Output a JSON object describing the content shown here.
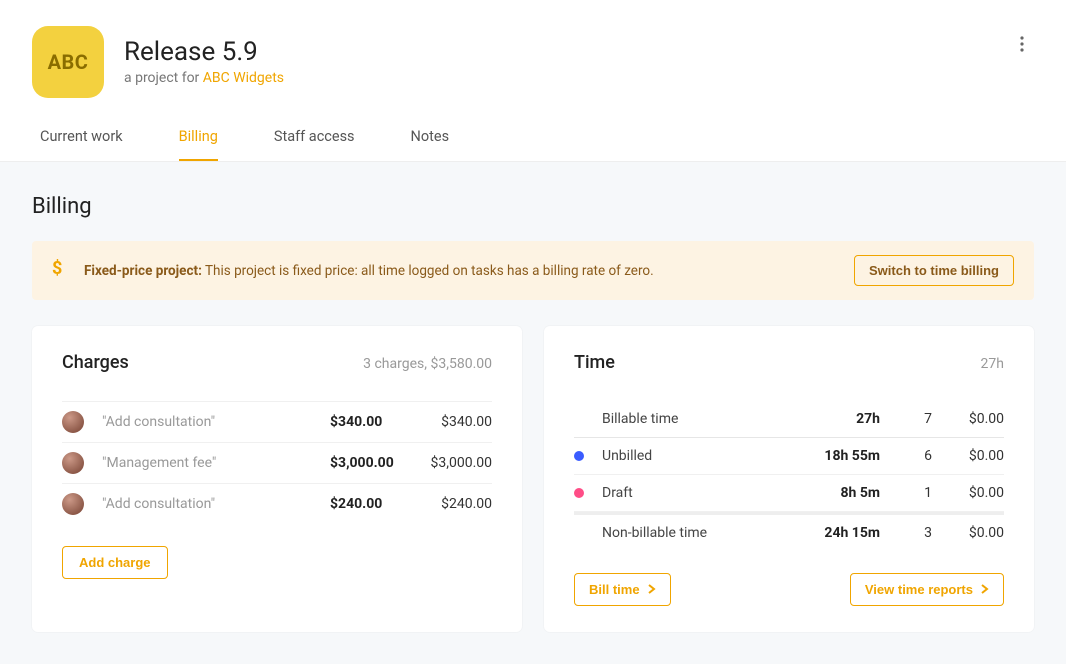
{
  "header": {
    "logo_text": "ABC",
    "title": "Release 5.9",
    "subtitle_prefix": "a project for ",
    "client_name": "ABC Widgets"
  },
  "tabs": {
    "current_work": "Current work",
    "billing": "Billing",
    "staff_access": "Staff access",
    "notes": "Notes",
    "active": "billing"
  },
  "section": {
    "title": "Billing"
  },
  "banner": {
    "heading": "Fixed-price project:",
    "description": " This project is fixed price: all time logged on tasks has a billing rate of zero.",
    "button": "Switch to time billing"
  },
  "charges": {
    "title": "Charges",
    "summary": "3 charges, $3,580.00",
    "items": [
      {
        "label": "\"Add consultation\"",
        "price": "$340.00",
        "total": "$340.00"
      },
      {
        "label": "\"Management fee\"",
        "price": "$3,000.00",
        "total": "$3,000.00"
      },
      {
        "label": "\"Add consultation\"",
        "price": "$240.00",
        "total": "$240.00"
      }
    ],
    "add_button": "Add charge"
  },
  "time": {
    "title": "Time",
    "summary": "27h",
    "rows": {
      "billable": {
        "label": "Billable time",
        "hours": "27h",
        "count": "7",
        "amount": "$0.00"
      },
      "unbilled": {
        "label": "Unbilled",
        "hours": "18h 55m",
        "count": "6",
        "amount": "$0.00"
      },
      "draft": {
        "label": "Draft",
        "hours": "8h 5m",
        "count": "1",
        "amount": "$0.00"
      },
      "nonbillable": {
        "label": "Non-billable time",
        "hours": "24h 15m",
        "count": "3",
        "amount": "$0.00"
      }
    },
    "bill_button": "Bill time",
    "reports_button": "View time reports"
  }
}
